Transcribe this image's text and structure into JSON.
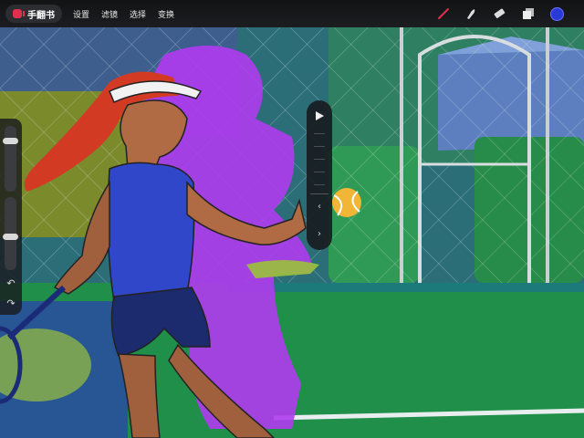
{
  "app": {
    "name": "手翻书"
  },
  "menu": {
    "items": [
      "设置",
      "滤镜",
      "选择",
      "变换"
    ]
  },
  "tools": {
    "brush": "brush-icon",
    "smudge": "smudge-icon",
    "eraser": "eraser-icon",
    "layers": "layers-icon",
    "active_color": "#2a3ad6"
  },
  "sidebar": {
    "size_slider_level": 0.2,
    "opacity_slider_level": 0.55,
    "undo_icon": "undo-arrow-icon",
    "redo_icon": "redo-arrow-icon"
  },
  "flipbook_panel": {
    "play_icon": "play-icon",
    "prev_icon": "chevron-left-icon",
    "next_icon": "chevron-right-icon"
  },
  "colors": {
    "toolbar": "#16181b",
    "accent_red": "#e0304e",
    "purple_onion_skin": "#b03bf0",
    "court_green": "#1f8f4a"
  }
}
